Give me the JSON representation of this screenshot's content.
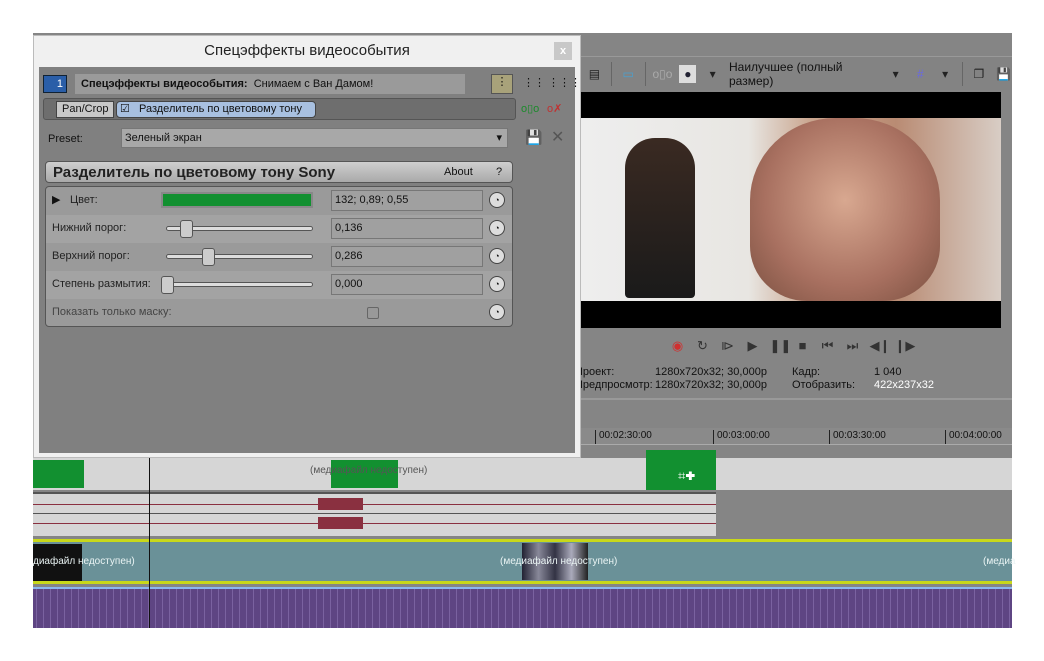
{
  "dialog": {
    "title": "Спецэффекты видеособытия",
    "close": "x",
    "header_label": "Спецэффекты видеособытия:",
    "header_event": "Снимаем с Ван Дамом!",
    "track_number": "1",
    "chain": [
      "Pan/Crop",
      "Разделитель по цветовому тону"
    ],
    "preset_label": "Preset:",
    "preset_value": "Зеленый экран",
    "plugin_title": "Разделитель по цветовому тону Sony",
    "about": "About",
    "help": "?",
    "params": [
      {
        "label": "Цвет:",
        "value": "132; 0,89; 0,55",
        "color": "#129030"
      },
      {
        "label": "Нижний порог:",
        "value": "0,136",
        "slider": 0.136
      },
      {
        "label": "Верхний порог:",
        "value": "0,286",
        "slider": 0.286
      },
      {
        "label": "Степень размытия:",
        "value": "0,000",
        "slider": 0.0
      },
      {
        "label": "Показать только маску:",
        "checked": false
      }
    ]
  },
  "preview": {
    "quality": "Наилучшее (полный размер)",
    "info": [
      {
        "k": "Проект:",
        "v": "1280x720x32; 30,000p",
        "k2": "Кадр:",
        "v2": "1 040"
      },
      {
        "k": "Предпросмотр:",
        "v": "1280x720x32; 30,000p",
        "k2": "Отобразить:",
        "v2": "422x237x32"
      }
    ]
  },
  "timeline": {
    "ticks": [
      "00:02:30:00",
      "00:03:00:00",
      "00:03:30:00",
      "00:04:00:00"
    ],
    "media_missing": "(медиафайл недоступен)",
    "media_missing_left": "диафайл недоступен)",
    "media_missing_right": "(медиа"
  }
}
